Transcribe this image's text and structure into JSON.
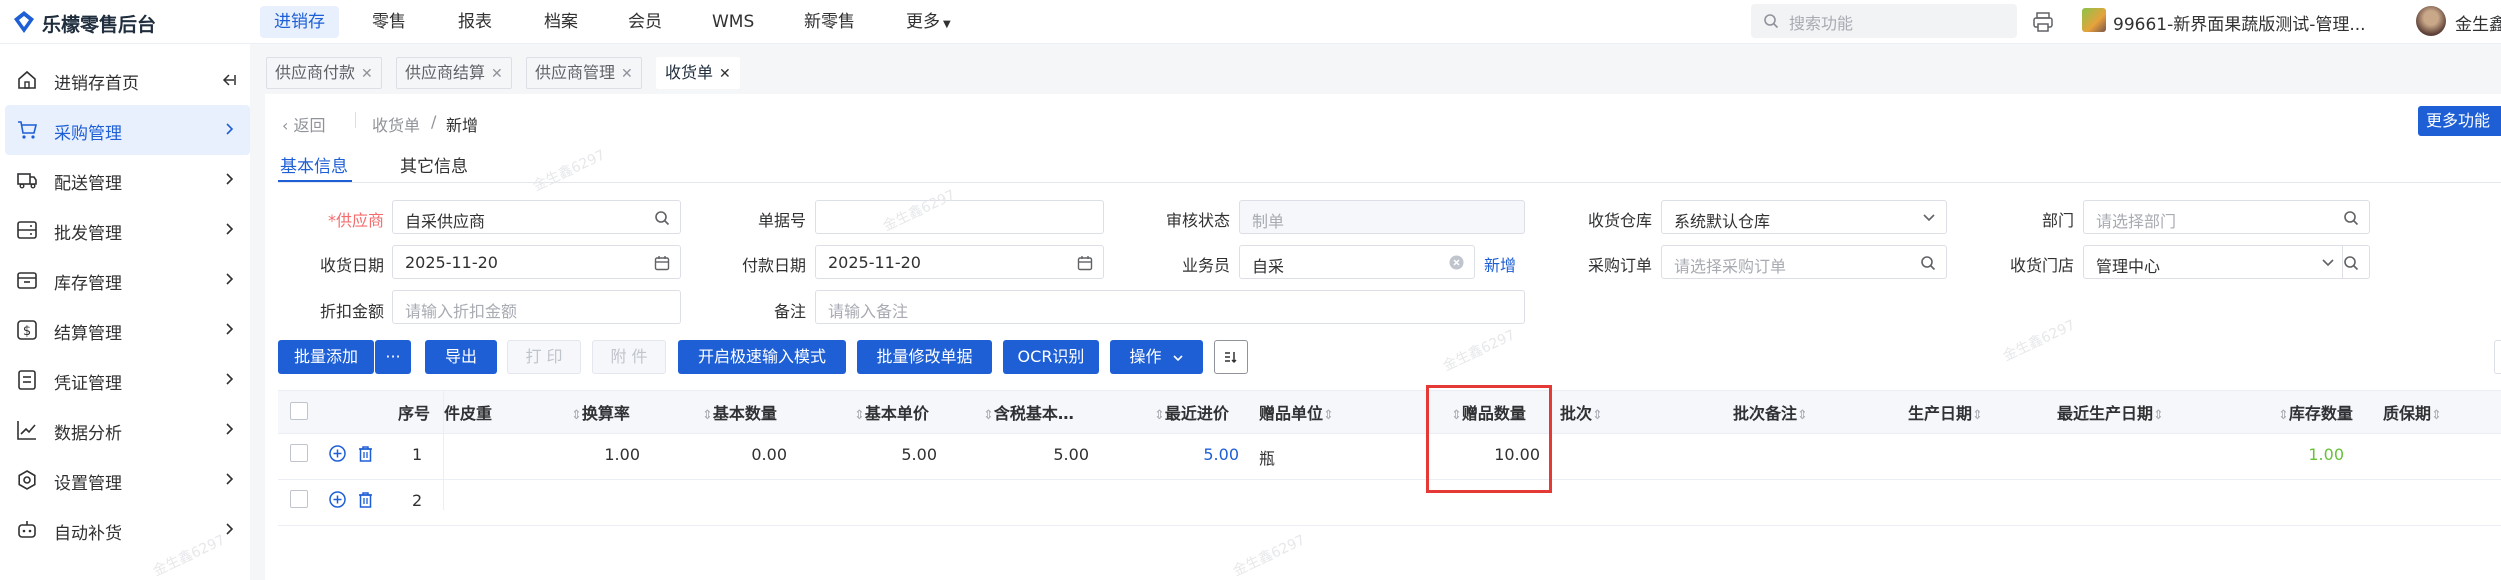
{
  "app": {
    "title": "乐檬零售后台"
  },
  "topnav": {
    "items": [
      "进销存",
      "零售",
      "报表",
      "档案",
      "会员",
      "WMS",
      "新零售",
      "更多"
    ]
  },
  "search": {
    "placeholder": "搜索功能"
  },
  "store": {
    "name": "99661-新界面果蔬版测试-管理..."
  },
  "user": {
    "name": "金生鑫"
  },
  "sidebar": {
    "items": [
      {
        "label": "进销存首页",
        "icon": "home-icon"
      },
      {
        "label": "采购管理",
        "icon": "cart-icon"
      },
      {
        "label": "配送管理",
        "icon": "truck-icon"
      },
      {
        "label": "批发管理",
        "icon": "server-icon"
      },
      {
        "label": "库存管理",
        "icon": "box-icon"
      },
      {
        "label": "结算管理",
        "icon": "dollar-icon"
      },
      {
        "label": "凭证管理",
        "icon": "document-icon"
      },
      {
        "label": "数据分析",
        "icon": "chart-line-icon"
      },
      {
        "label": "设置管理",
        "icon": "gear-icon"
      },
      {
        "label": "自动补货",
        "icon": "robot-icon"
      }
    ]
  },
  "tabs": [
    {
      "label": "供应商付款"
    },
    {
      "label": "供应商结算"
    },
    {
      "label": "供应商管理"
    },
    {
      "label": "收货单"
    }
  ],
  "breadcrumb": {
    "back": "返回",
    "parent": "收货单",
    "sep": "/",
    "current": "新增"
  },
  "more_button": "更多功能",
  "subtabs": [
    "基本信息",
    "其它信息"
  ],
  "form": {
    "supplier": {
      "label": "供应商",
      "value": "自采供应商"
    },
    "doc_no": {
      "label": "单据号",
      "value": ""
    },
    "review_status": {
      "label": "审核状态",
      "placeholder": "制单"
    },
    "warehouse": {
      "label": "收货仓库",
      "value": "系统默认仓库"
    },
    "department": {
      "label": "部门",
      "placeholder": "请选择部门"
    },
    "receive_date": {
      "label": "收货日期",
      "value": "2025-11-20"
    },
    "pay_date": {
      "label": "付款日期",
      "value": "2025-11-20"
    },
    "salesman": {
      "label": "业务员",
      "value": "自采",
      "add": "新增"
    },
    "purchase_order": {
      "label": "采购订单",
      "placeholder": "请选择采购订单"
    },
    "receive_store": {
      "label": "收货门店",
      "value": "管理中心"
    },
    "discount": {
      "label": "折扣金额",
      "placeholder": "请输入折扣金额"
    },
    "remark": {
      "label": "备注",
      "placeholder": "请输入备注"
    }
  },
  "toolbar": {
    "batch_add": "批量添加",
    "more": "···",
    "export": "导出",
    "print": "打 印",
    "attach": "附 件",
    "fast_input": "开启极速输入模式",
    "batch_edit": "批量修改单据",
    "ocr": "OCR识别",
    "operate": "操作"
  },
  "table": {
    "headers": {
      "seq": "序号",
      "tare": "件皮重",
      "rate": "换算率",
      "base_qty": "基本数量",
      "base_price": "基本单价",
      "tax_price": "含税基本…",
      "last_price": "最近进价",
      "gift_unit": "赠品单位",
      "gift_qty": "赠品数量",
      "batch": "批次",
      "batch_note": "批次备注",
      "prod_date": "生产日期",
      "last_prod_date": "最近生产日期",
      "stock_qty": "库存数量",
      "shelf_life": "质保期"
    },
    "rows": [
      {
        "seq": "1",
        "rate": "1.00",
        "base_qty": "0.00",
        "base_price": "5.00",
        "tax_price": "5.00",
        "last_price": "5.00",
        "gift_unit": "瓶",
        "gift_qty": "10.00",
        "stock_qty": "1.00"
      },
      {
        "seq": "2"
      }
    ]
  },
  "watermark": "金生鑫6297",
  "colors": {
    "primary": "#1e5fd6",
    "highlight": "#e53935",
    "stock_green": "#67c23a",
    "required": "#f56c6c"
  }
}
